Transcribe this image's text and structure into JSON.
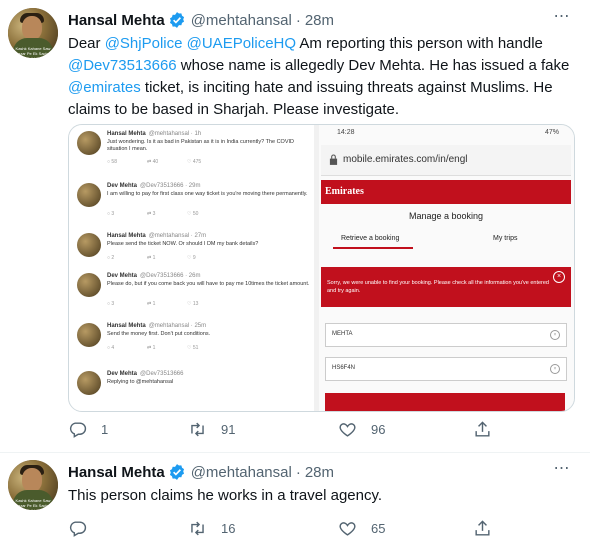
{
  "tweets": [
    {
      "author_name": "Hansal Mehta",
      "handle": "@mehtahansal",
      "time": "28m",
      "text_parts": [
        {
          "t": "Dear ",
          "link": false
        },
        {
          "t": "@ShjPolice",
          "link": true
        },
        {
          "t": " ",
          "link": false
        },
        {
          "t": "@UAEPoliceHQ",
          "link": true
        },
        {
          "t": " Am reporting this person with handle ",
          "link": false
        },
        {
          "t": "@Dev73513666",
          "link": true
        },
        {
          "t": " whose name is allegedly Dev Mehta. He has issued a fake ",
          "link": false
        },
        {
          "t": "@emirates",
          "link": true
        },
        {
          "t": " ticket, is inciting hate and issuing threats against Muslims. He claims to be based in Sharjah. Please investigate.",
          "link": false
        }
      ],
      "replies": "1",
      "retweets": "91",
      "likes": "96"
    },
    {
      "author_name": "Hansal Mehta",
      "handle": "@mehtahansal",
      "time": "28m",
      "text_parts": [
        {
          "t": "This person claims he works in a travel agency.",
          "link": false
        }
      ],
      "replies": "",
      "retweets": "16",
      "likes": "65"
    }
  ],
  "avatar_caption": "Kashk Kahane Saw Hazar Pe Ek Sachai Hoti Hai",
  "media": {
    "left_thread": [
      {
        "name": "Hansal Mehta",
        "meta": "@mehtahansal · 1h",
        "text": "Just wondering. Is it as bad in Pakistan as it is in India currently? The COVID situation I mean.",
        "counts": [
          "58",
          "40",
          "475"
        ]
      },
      {
        "name": "Dev Mehta",
        "meta": "@Dev73513666 · 29m",
        "text": "I am willing to pay for first class one way ticket is you're moving there permanently.",
        "counts": [
          "3",
          "3",
          "50"
        ]
      },
      {
        "name": "Hansal Mehta",
        "meta": "@mehtahansal · 27m",
        "text": "Please send the ticket NOW. Or should I DM my bank details?",
        "counts": [
          "2",
          "1",
          "9"
        ]
      },
      {
        "name": "Dev Mehta",
        "meta": "@Dev73513666 · 26m",
        "text": "Please do, but if you come back you will have to pay me 10times the ticket amount.",
        "counts": [
          "3",
          "1",
          "13"
        ]
      },
      {
        "name": "Hansal Mehta",
        "meta": "@mehtahansal · 25m",
        "text": "Send the money first. Don't put conditions.",
        "counts": [
          "4",
          "1",
          "51"
        ]
      },
      {
        "name": "Dev Mehta",
        "meta": "@Dev73513666",
        "text": "Replying to @mehtahansal",
        "counts": []
      }
    ],
    "phone": {
      "status_time": "14:28",
      "battery": "47%",
      "url": "mobile.emirates.com/in/engl",
      "brand": "Emirates",
      "manage_title": "Manage a booking",
      "tab_retrieve": "Retrieve a booking",
      "tab_trips": "My trips",
      "error_text": "Sorry, we were unable to find your booking. Please check all the information you've entered and try again.",
      "field_name": "MEHTA",
      "field_ref": "HS6F4N"
    }
  },
  "colors": {
    "link": "#1d9bf0",
    "secondary": "#536471",
    "emirates_red": "#c1101d"
  }
}
